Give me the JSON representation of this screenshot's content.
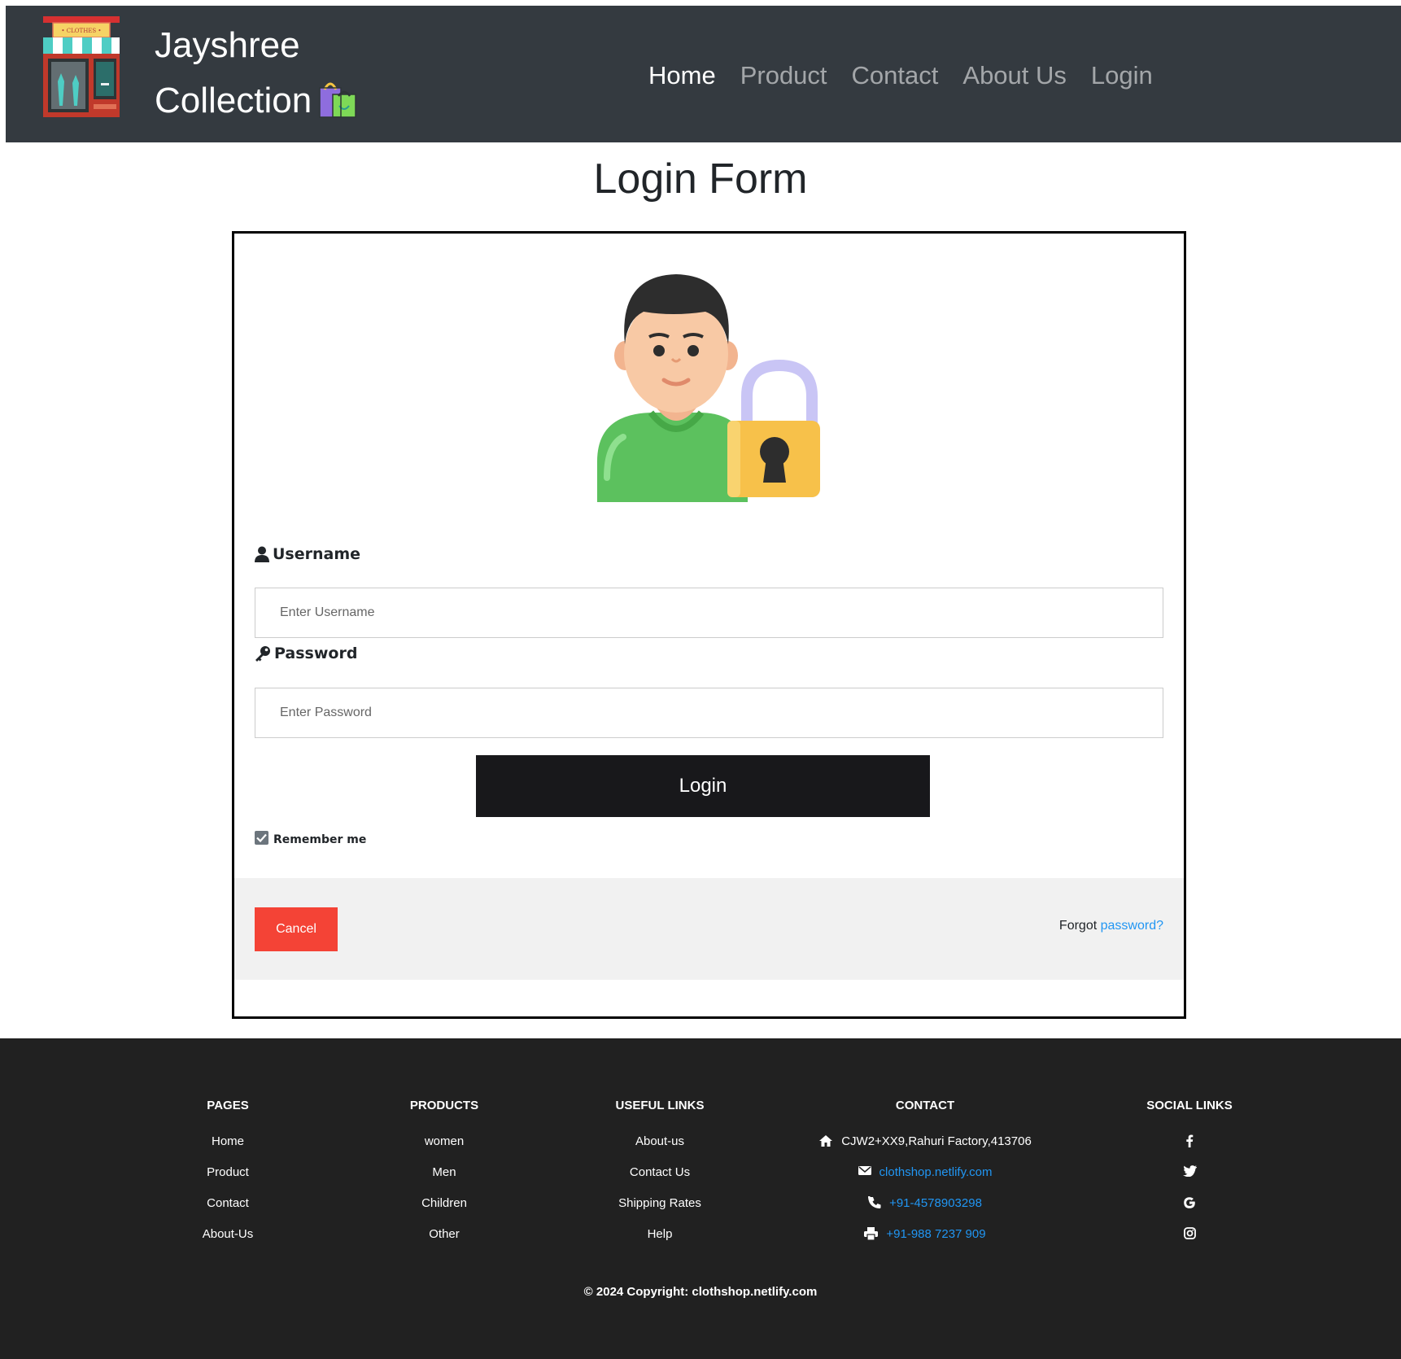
{
  "navbar": {
    "brand_line1": "Jayshree",
    "brand_line2": "Collection",
    "logo_sign": "• CLOTHES •",
    "links": [
      {
        "label": "Home",
        "active": true
      },
      {
        "label": "Product",
        "active": false
      },
      {
        "label": "Contact",
        "active": false
      },
      {
        "label": "About Us",
        "active": false
      },
      {
        "label": "Login",
        "active": false
      }
    ]
  },
  "page": {
    "title": "Login Form"
  },
  "form": {
    "username_label": "Username",
    "username_placeholder": "Enter Username",
    "username_value": "",
    "password_label": "Password",
    "password_placeholder": "Enter Password",
    "password_value": "",
    "login_button": "Login",
    "remember_label": "Remember me",
    "remember_checked": true,
    "cancel_button": "Cancel",
    "forgot_prefix": "Forgot",
    "forgot_link": "password?"
  },
  "footer": {
    "columns": [
      {
        "heading": "PAGES",
        "items": [
          "Home",
          "Product",
          "Contact",
          "About-Us"
        ]
      },
      {
        "heading": "PRODUCTS",
        "items": [
          "women",
          "Men",
          "Children",
          "Other"
        ]
      },
      {
        "heading": "USEFUL LINKS",
        "items": [
          "About-us",
          "Contact Us",
          "Shipping Rates",
          "Help"
        ]
      }
    ],
    "contact": {
      "heading": "CONTACT",
      "address": "CJW2+XX9,Rahuri Factory,413706",
      "email": "clothshop.netlify.com",
      "phone": "+91-4578903298",
      "fax": "+91-988 7237 909"
    },
    "social": {
      "heading": "SOCIAL LINKS",
      "icons": [
        "facebook-icon",
        "twitter-icon",
        "google-icon",
        "instagram-icon"
      ]
    },
    "copyright": "© 2024 Copyright: clothshop.netlify.com"
  },
  "colors": {
    "navbar_bg": "#343a40",
    "footer_bg": "#212121",
    "cancel_red": "#f44336",
    "link_blue": "#2196f3",
    "login_button_bg": "#18181b"
  }
}
